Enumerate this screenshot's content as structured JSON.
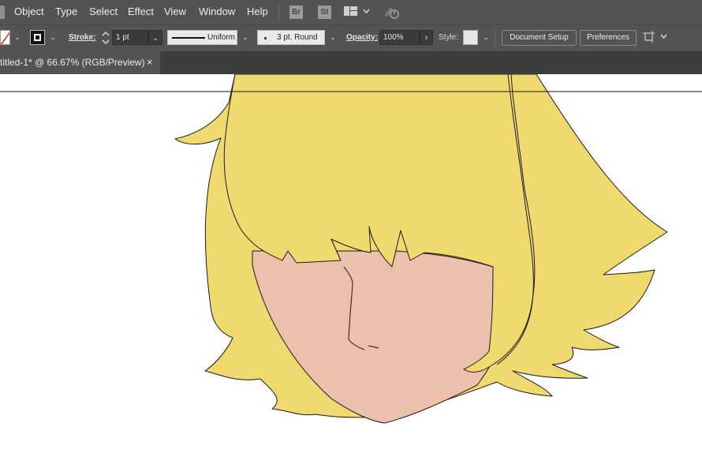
{
  "menubar": {
    "items": [
      "Object",
      "Type",
      "Select",
      "Effect",
      "View",
      "Window",
      "Help"
    ],
    "bridge_label": "Br",
    "stock_label": "St"
  },
  "controlbar": {
    "stroke_label": "Stroke:",
    "stroke_weight": "1 pt",
    "profile_value": "Uniform",
    "brush_value": "3 pt. Round",
    "opacity_label": "Opacity:",
    "opacity_value": "100%",
    "style_label": "Style:",
    "document_setup_label": "Document Setup",
    "preferences_label": "Preferences"
  },
  "tab": {
    "title": "titled-1* @ 66.67% (RGB/Preview)",
    "close_glyph": "×"
  },
  "artwork": {
    "hair_color": "#F0D96E",
    "skin_color": "#ECC0AC",
    "outline_color": "#1a1a1a"
  },
  "colors": {
    "ui_dark": "#535353",
    "ui_tabbar": "#3d3d3d",
    "ui_field": "#3b3b3b",
    "canvas": "#ffffff"
  }
}
